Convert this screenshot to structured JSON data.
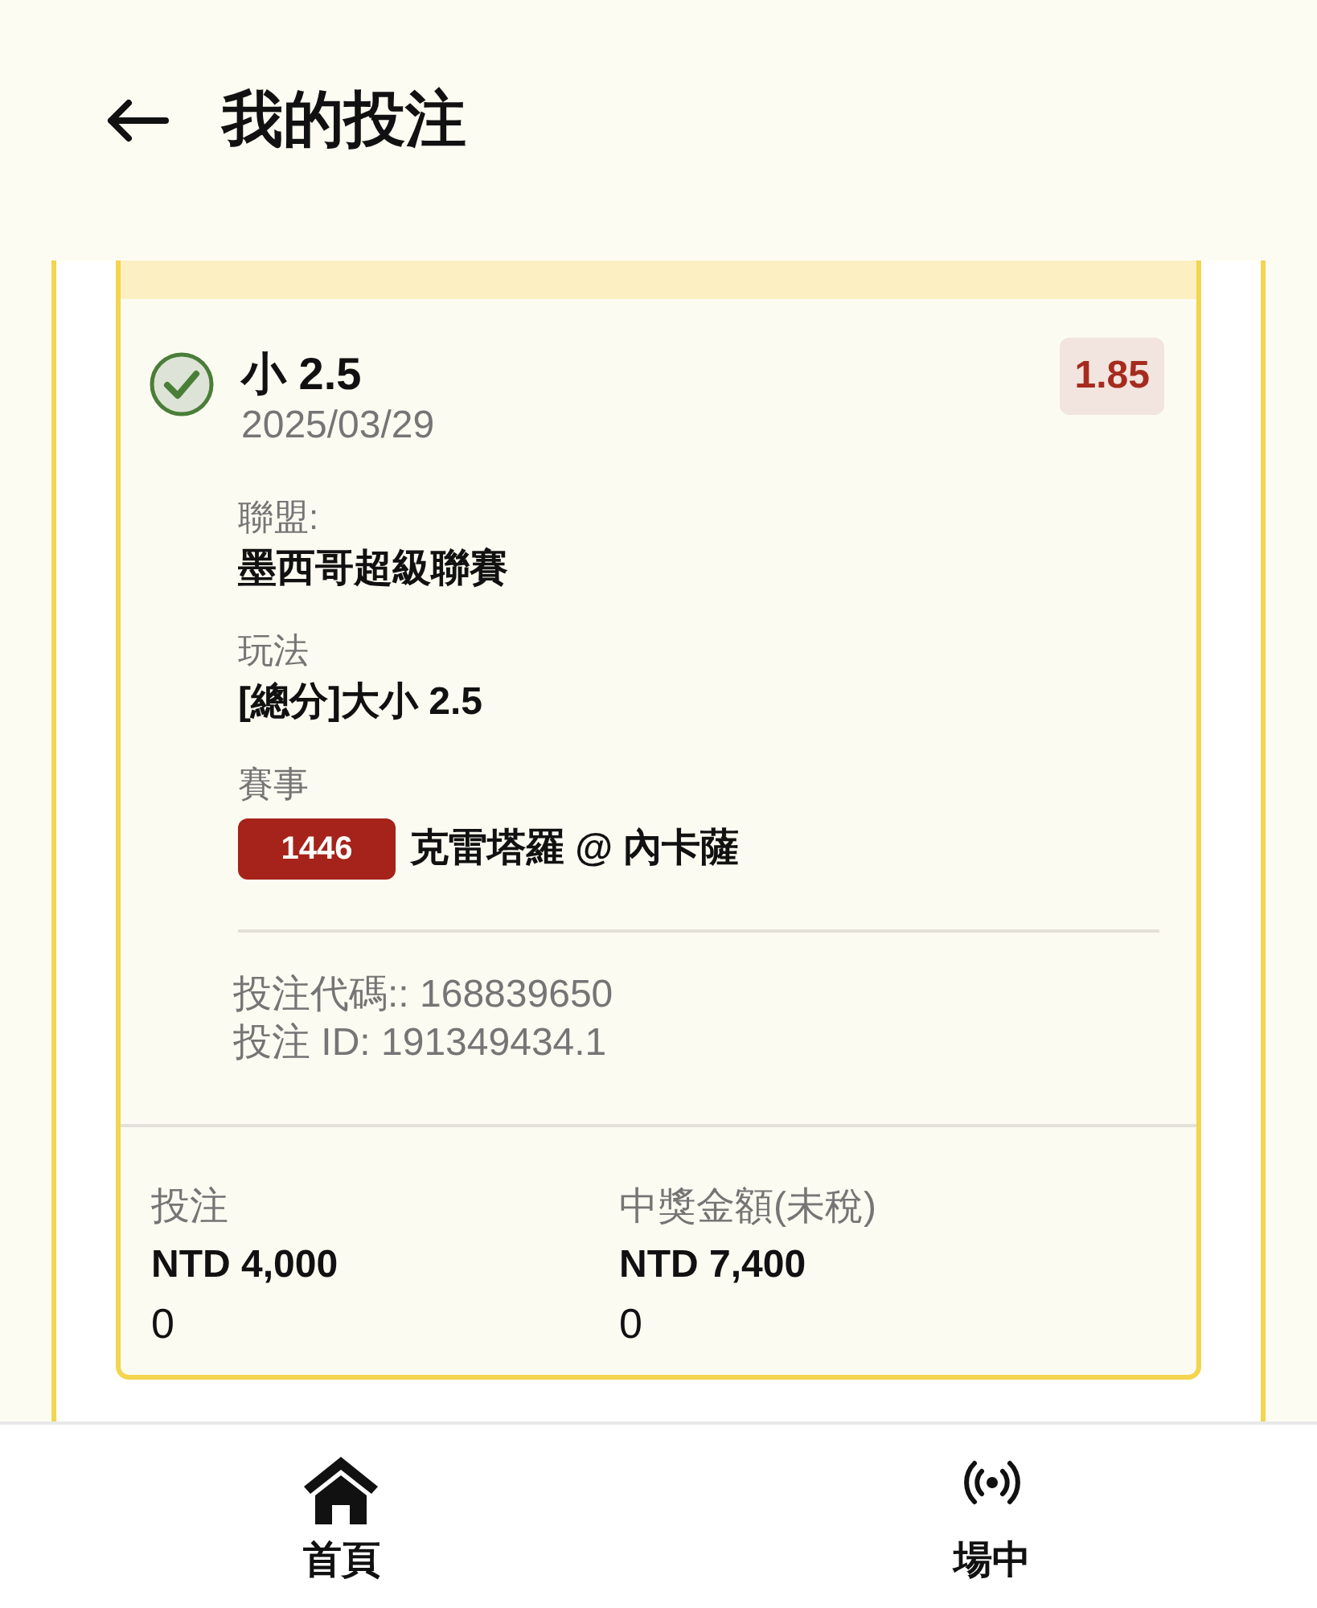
{
  "header": {
    "title": "我的投注"
  },
  "bet": {
    "won": true,
    "selection": "小 2.5",
    "date": "2025/03/29",
    "odds": "1.85",
    "fields": [
      {
        "label": "聯盟:",
        "value": "墨西哥超級聯賽"
      },
      {
        "label": "玩法",
        "value": "[總分]大小 2.5"
      }
    ],
    "match": {
      "label": "賽事",
      "number": "1446",
      "teams": "克雷塔羅 @ 內卡薩"
    },
    "references": [
      "投注代碼:: 168839650",
      "投注 ID: 191349434.1"
    ],
    "amounts": [
      {
        "label": "投注",
        "amount": "NTD 4,000",
        "extra": "0"
      },
      {
        "label": "中獎金額(未稅)",
        "amount": "NTD 7,400",
        "extra": "0"
      }
    ]
  },
  "bottom_nav": [
    {
      "kind": "home",
      "label": "首頁"
    },
    {
      "kind": "live",
      "label": "場中"
    }
  ]
}
